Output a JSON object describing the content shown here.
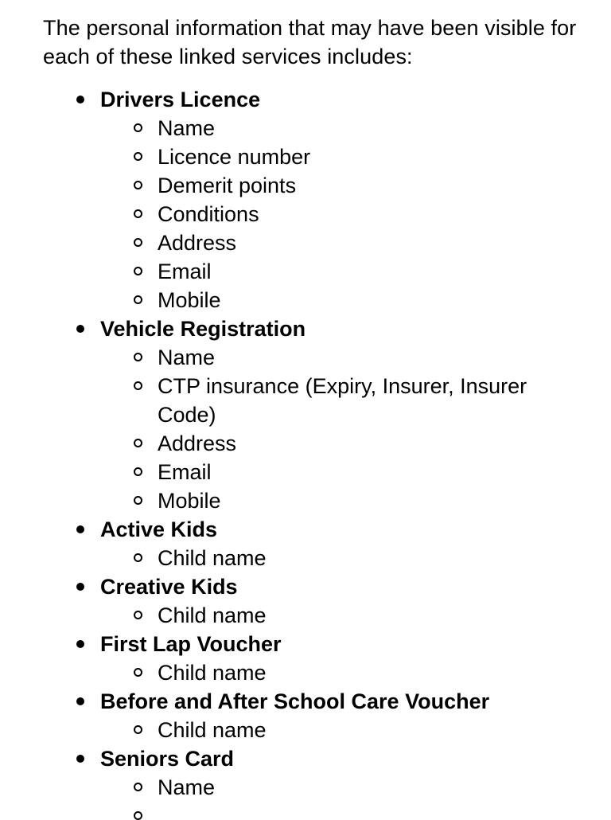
{
  "intro": "The personal information that may have been visible for each of these linked services includes:",
  "services": [
    {
      "label": "Drivers Licence",
      "fields": [
        "Name",
        "Licence number",
        "Demerit points",
        "Conditions",
        "Address",
        "Email",
        "Mobile"
      ]
    },
    {
      "label": "Vehicle Registration",
      "fields": [
        "Name",
        "CTP insurance (Expiry, Insurer, Insurer Code)",
        "Address",
        "Email",
        "Mobile"
      ]
    },
    {
      "label": "Active Kids",
      "fields": [
        "Child name"
      ]
    },
    {
      "label": "Creative Kids",
      "fields": [
        "Child name"
      ]
    },
    {
      "label": "First Lap Voucher",
      "fields": [
        "Child name"
      ]
    },
    {
      "label": "Before and After School Care Voucher",
      "fields": [
        "Child name"
      ]
    },
    {
      "label": "Seniors Card",
      "fields": [
        "Name",
        ""
      ]
    }
  ]
}
